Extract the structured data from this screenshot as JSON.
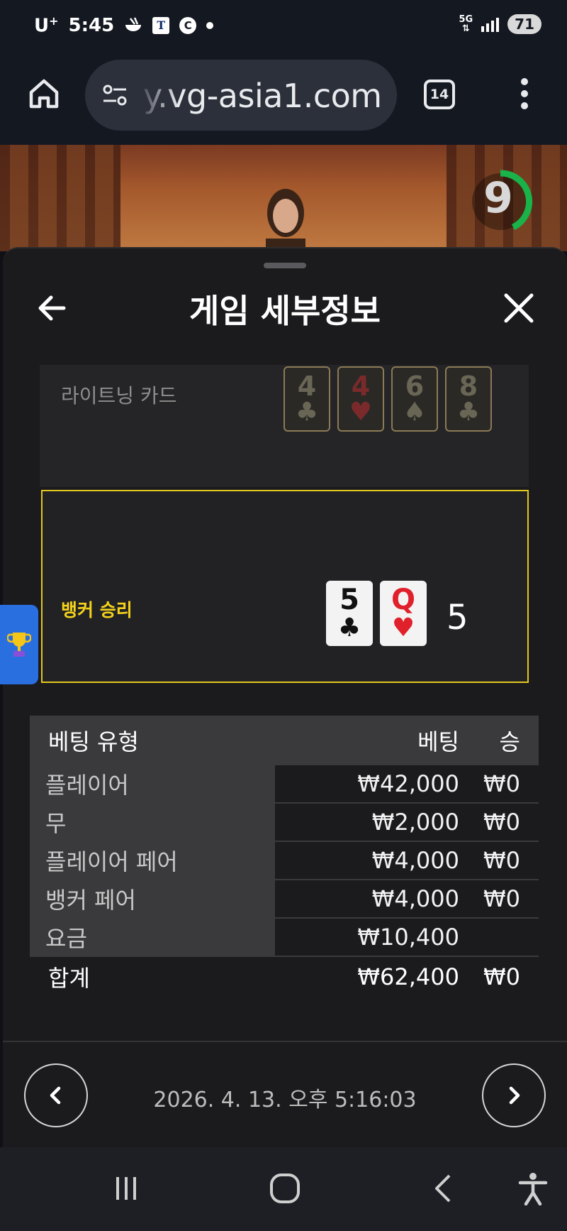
{
  "status_bar": {
    "carrier": "U",
    "carrier_sup": "+",
    "time": "5:45",
    "notif_t": "T",
    "notif_c": "C",
    "network": "5G",
    "battery": "71"
  },
  "browser": {
    "url": "y.vg-asia1.com",
    "tab_count": "14"
  },
  "stream": {
    "timer_value": "9"
  },
  "sheet": {
    "title": "게임 세부정보",
    "lightning_label": "라이트닝 카드",
    "lightning_cards": [
      {
        "rank": "4",
        "suit": "♣",
        "color": "black"
      },
      {
        "rank": "4",
        "suit": "♥",
        "color": "red"
      },
      {
        "rank": "6",
        "suit": "♠",
        "color": "black"
      },
      {
        "rank": "8",
        "suit": "♣",
        "color": "black"
      }
    ],
    "result_label": "뱅커 승리",
    "result_cards": [
      {
        "rank": "5",
        "suit": "♣",
        "color": "black"
      },
      {
        "rank": "Q",
        "suit": "♥",
        "color": "red"
      }
    ],
    "result_score": "5",
    "accent_color": "#e3c81e"
  },
  "bet_table": {
    "headers": {
      "type": "베팅 유형",
      "bet": "베팅",
      "win": "승"
    },
    "rows": [
      {
        "type": "플레이어",
        "bet": "₩42,000",
        "win": "₩0"
      },
      {
        "type": "무",
        "bet": "₩2,000",
        "win": "₩0"
      },
      {
        "type": "플레이어 페어",
        "bet": "₩4,000",
        "win": "₩0"
      },
      {
        "type": "뱅커 페어",
        "bet": "₩4,000",
        "win": "₩0"
      },
      {
        "type": "요금",
        "bet": "₩10,400",
        "win": ""
      }
    ],
    "total": {
      "type": "합계",
      "bet": "₩62,400",
      "win": "₩0"
    }
  },
  "footer": {
    "timestamp": "2026. 4. 13. 오후 5:16:03"
  }
}
